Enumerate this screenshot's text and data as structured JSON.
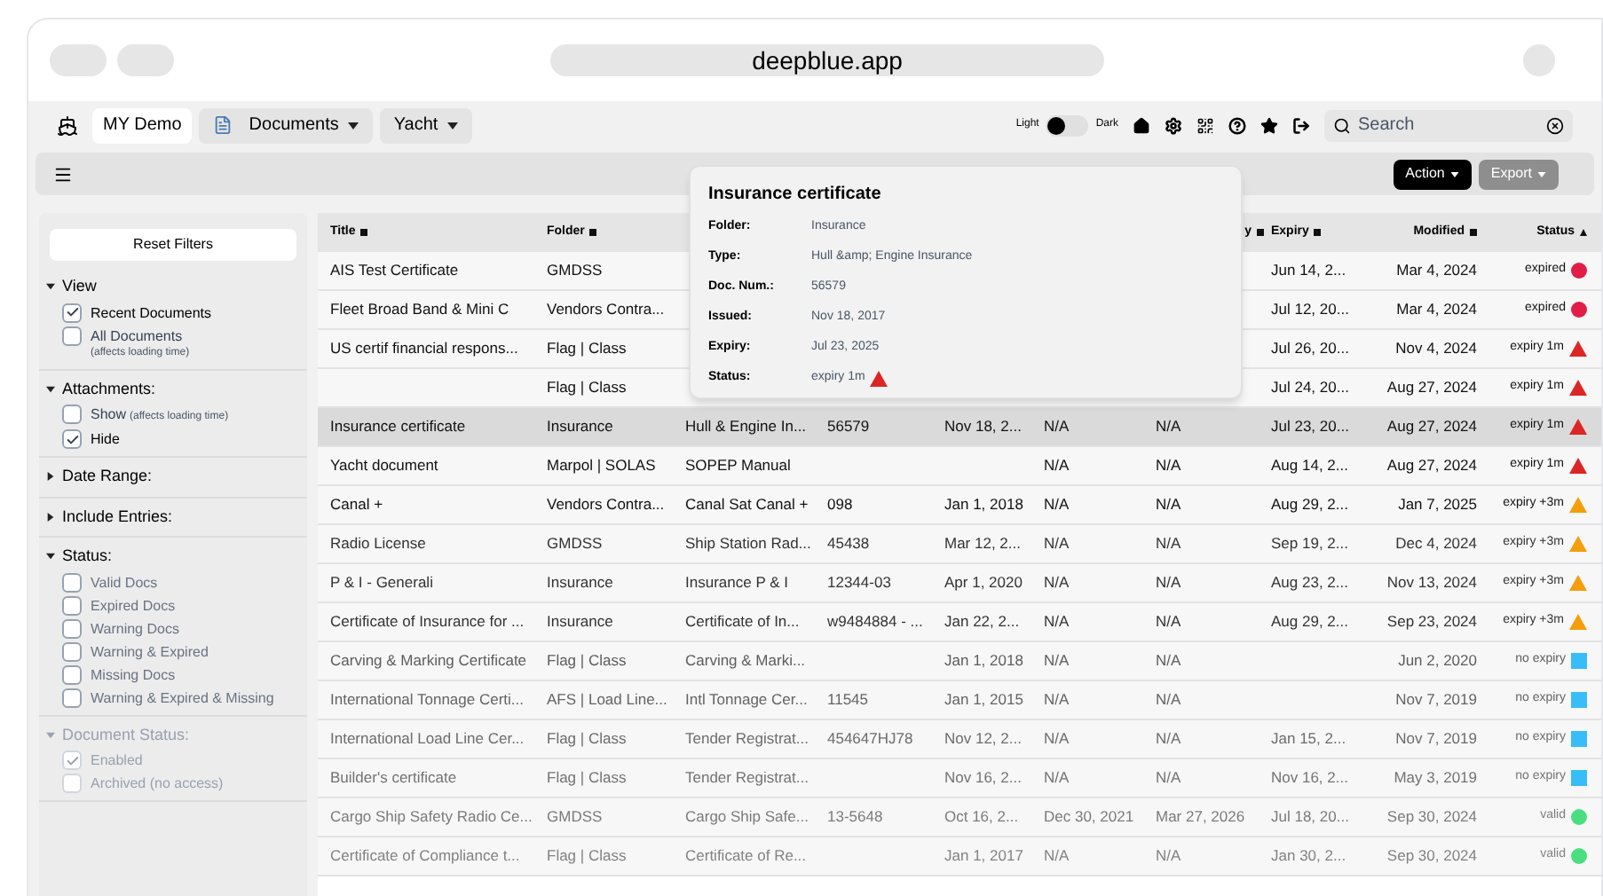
{
  "browser": {
    "address": "deepblue.app"
  },
  "nav": {
    "account": "MY Demo",
    "menus": [
      {
        "label": "Documents",
        "kind": "doc"
      },
      {
        "label": "Yacht",
        "kind": "plain"
      }
    ],
    "theme": {
      "light_label": "Light",
      "dark_label": "Dark",
      "on": false
    },
    "search": {
      "placeholder": "Search"
    }
  },
  "toolbar": {
    "buttons": [
      {
        "label": "Action",
        "kind": "primary"
      },
      {
        "label": "Export",
        "kind": "secondary"
      }
    ]
  },
  "sidebar": {
    "reset": "Reset Filters",
    "sections": [
      {
        "title": "View",
        "expanded": true,
        "disabled": false,
        "items": [
          {
            "label": "Recent Documents",
            "checked": true
          },
          {
            "label": "All Documents",
            "note": "(affects loading time)",
            "note_below": true,
            "checked": false
          }
        ]
      },
      {
        "title": "Attachments:",
        "expanded": true,
        "disabled": false,
        "items": [
          {
            "label": "Show",
            "note": "(affects loading time)",
            "note_below": false,
            "checked": false
          },
          {
            "label": "Hide",
            "checked": true
          }
        ]
      },
      {
        "title": "Date Range:",
        "expanded": false,
        "disabled": false
      },
      {
        "title": "Include Entries:",
        "expanded": false,
        "disabled": false
      },
      {
        "title": "Status:",
        "expanded": true,
        "disabled": false,
        "items": [
          {
            "label": "Valid Docs",
            "checked": false
          },
          {
            "label": "Expired Docs",
            "checked": false
          },
          {
            "label": "Warning Docs",
            "checked": false
          },
          {
            "label": "Warning & Expired",
            "checked": false
          },
          {
            "label": "Missing Docs",
            "checked": false
          },
          {
            "label": "Warning & Expired & Missing",
            "checked": false
          }
        ]
      },
      {
        "title": "Document Status:",
        "expanded": true,
        "disabled": true,
        "items": [
          {
            "label": "Enabled",
            "checked": true
          },
          {
            "label": "Archived (no access)",
            "checked": false
          }
        ]
      }
    ]
  },
  "table": {
    "columns": [
      {
        "label": "Title"
      },
      {
        "label": "Folder"
      },
      {},
      {},
      {},
      {},
      {
        "label": "y"
      },
      {
        "label": "Expiry"
      },
      {
        "label": "Modified"
      },
      {
        "label": "Status"
      }
    ],
    "rows": [
      {
        "selected": false,
        "title": "AIS Test Certificate",
        "folder": "GMDSS",
        "expiry": "Jun 14, 2...",
        "modified": "Mar 4, 2024",
        "status": {
          "text": "expired",
          "kind": "circle",
          "color": "#e11d48"
        }
      },
      {
        "selected": false,
        "title": "Fleet Broad Band & Mini C",
        "folder": "Vendors Contra...",
        "expiry": "Jul 12, 20...",
        "modified": "Mar 4, 2024",
        "status": {
          "text": "expired",
          "kind": "circle",
          "color": "#e11d48"
        }
      },
      {
        "selected": false,
        "title": "US certif financial respons...",
        "folder": "Flag | Class",
        "expiry": "Jul 26, 20...",
        "modified": "Nov 4, 2024",
        "status": {
          "text": "expiry 1m",
          "kind": "triangle",
          "color": "#dc2626"
        }
      },
      {
        "selected": false,
        "folder": "Flag | Class",
        "expiry": "Jul 24, 20...",
        "modified": "Aug 27, 2024",
        "status": {
          "text": "expiry 1m",
          "kind": "triangle",
          "color": "#dc2626"
        }
      },
      {
        "selected": true,
        "title": "Insurance certificate",
        "folder": "Insurance",
        "type": "Hull & Engine In...",
        "doc_num": "56579",
        "issued": "Nov 18, 2...",
        "column_6": "N/A",
        "column_7": "N/A",
        "expiry": "Jul 23, 20...",
        "modified": "Aug 27, 2024",
        "status": {
          "text": "expiry 1m",
          "kind": "triangle",
          "color": "#dc2626"
        }
      },
      {
        "selected": false,
        "title": "Yacht document",
        "folder": "Marpol | SOLAS",
        "type": "SOPEP Manual",
        "column_6": "N/A",
        "column_7": "N/A",
        "expiry": "Aug 14, 2...",
        "modified": "Aug 27, 2024",
        "status": {
          "text": "expiry 1m",
          "kind": "triangle",
          "color": "#dc2626"
        }
      },
      {
        "selected": false,
        "title": "Canal +",
        "folder": "Vendors Contra...",
        "type": "Canal Sat Canal +",
        "doc_num": "098",
        "issued": "Jan 1, 2018",
        "column_6": "N/A",
        "column_7": "N/A",
        "expiry": "Aug 29, 2...",
        "modified": "Jan 7, 2025",
        "status": {
          "text": "expiry +3m",
          "kind": "triangle",
          "color": "#f59e0b"
        }
      },
      {
        "selected": false,
        "title": "Radio License",
        "folder": "GMDSS",
        "type": "Ship Station Rad...",
        "doc_num": "45438",
        "issued": "Mar 12, 2...",
        "column_6": "N/A",
        "column_7": "N/A",
        "expiry": "Sep 19, 2...",
        "modified": "Dec 4, 2024",
        "status": {
          "text": "expiry +3m",
          "kind": "triangle",
          "color": "#f59e0b"
        }
      },
      {
        "selected": false,
        "title": "P & I - Generali",
        "folder": "Insurance",
        "type": "Insurance P & I",
        "doc_num": "12344-03",
        "issued": "Apr 1, 2020",
        "column_6": "N/A",
        "column_7": "N/A",
        "expiry": "Aug 23, 2...",
        "modified": "Nov 13, 2024",
        "status": {
          "text": "expiry +3m",
          "kind": "triangle",
          "color": "#f59e0b"
        }
      },
      {
        "selected": false,
        "title": "Certificate of Insurance for ...",
        "folder": "Insurance",
        "type": "Certificate of In...",
        "doc_num": "w9484884 - ...",
        "issued": "Jan 22, 2...",
        "column_6": "N/A",
        "column_7": "N/A",
        "expiry": "Aug 29, 2...",
        "modified": "Sep 23, 2024",
        "status": {
          "text": "expiry +3m",
          "kind": "triangle",
          "color": "#f59e0b"
        }
      },
      {
        "selected": false,
        "title": "Carving & Marking Certificate",
        "folder": "Flag | Class",
        "type": "Carving & Marki...",
        "issued": "Jan 1, 2018",
        "column_6": "N/A",
        "column_7": "N/A",
        "modified": "Jun 2, 2020",
        "status": {
          "text": "no expiry",
          "kind": "square",
          "color": "#38bdf8"
        }
      },
      {
        "selected": false,
        "title": "International Tonnage Certi...",
        "folder": "AFS | Load Line...",
        "type": "Intl Tonnage Cer...",
        "doc_num": "11545",
        "issued": "Jan 1, 2015",
        "column_6": "N/A",
        "column_7": "N/A",
        "modified": "Nov 7, 2019",
        "status": {
          "text": "no expiry",
          "kind": "square",
          "color": "#38bdf8"
        }
      },
      {
        "selected": false,
        "title": "International Load Line Cer...",
        "folder": "Flag | Class",
        "type": "Tender Registrat...",
        "doc_num": "454647HJ78",
        "issued": "Nov 12, 2...",
        "column_6": "N/A",
        "column_7": "N/A",
        "expiry": "Jan 15, 2...",
        "modified": "Nov 7, 2019",
        "status": {
          "text": "no expiry",
          "kind": "square",
          "color": "#38bdf8"
        }
      },
      {
        "selected": false,
        "title": "Builder's certificate",
        "folder": "Flag | Class",
        "type": "Tender Registrat...",
        "issued": "Nov 16, 2...",
        "column_6": "N/A",
        "column_7": "N/A",
        "expiry": "Nov 16, 2...",
        "modified": "May 3, 2019",
        "status": {
          "text": "no expiry",
          "kind": "square",
          "color": "#38bdf8"
        }
      },
      {
        "selected": false,
        "title": "Cargo Ship Safety Radio Ce...",
        "folder": "GMDSS",
        "type": "Cargo Ship Safe...",
        "doc_num": "13-5648",
        "issued": "Oct 16, 2...",
        "column_6": "Dec 30, 2021",
        "column_7": "Mar 27, 2026",
        "expiry": "Jul 18, 20...",
        "modified": "Sep 30, 2024",
        "status": {
          "text": "valid",
          "kind": "circle",
          "color": "#4ade80"
        }
      },
      {
        "selected": false,
        "title": "Certificate of Compliance t...",
        "folder": "Flag | Class",
        "type": "Certificate of Re...",
        "issued": "Jan 1, 2017",
        "column_6": "N/A",
        "column_7": "N/A",
        "expiry": "Jan 30, 2...",
        "modified": "Sep 30, 2024",
        "status": {
          "text": "valid",
          "kind": "circle",
          "color": "#4ade80"
        }
      }
    ]
  },
  "tooltip": {
    "title": "Insurance certificate",
    "fields": [
      {
        "label": "Folder:",
        "value": "Insurance"
      },
      {
        "label": "Type:",
        "value": "Hull &amp; Engine Insurance"
      },
      {
        "label": "Doc. Num.:",
        "value": "56579"
      },
      {
        "label": "Issued:",
        "value": "Nov 18, 2017"
      },
      {
        "label": "Expiry:",
        "value": "Jul 23, 2025"
      },
      {
        "label": "Status:",
        "value": "expiry 1m",
        "status": {
          "kind": "triangle",
          "color": "#dc2626"
        }
      }
    ]
  }
}
